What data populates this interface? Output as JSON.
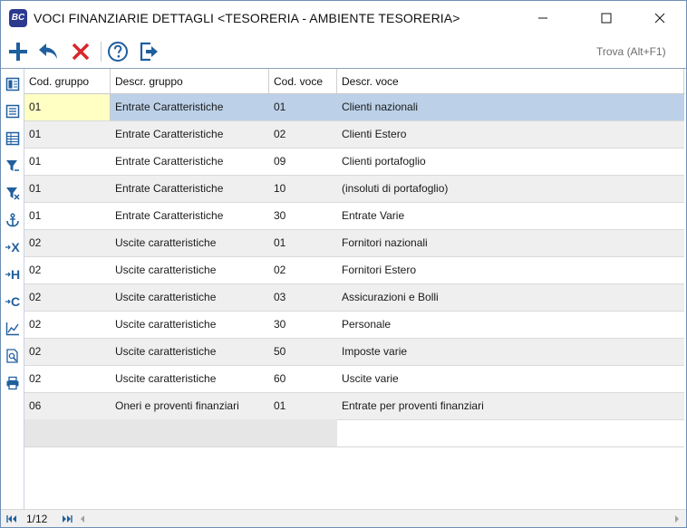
{
  "app": {
    "icon_text": "BC",
    "title": "VOCI FINANZIARIE DETTAGLI <TESORERIA - AMBIENTE TESORERIA>"
  },
  "window_controls": {
    "icons": [
      "minimize-icon",
      "maximize-icon",
      "close-icon"
    ]
  },
  "toolbar": {
    "icons": [
      "add-icon",
      "undo-icon",
      "delete-icon",
      "help-icon",
      "exit-icon"
    ],
    "search_placeholder": "Trova (Alt+F1)"
  },
  "sidebar": {
    "icons": [
      "form-view-icon",
      "list-view-icon",
      "grid-view-icon",
      "filter-icon",
      "filter-clear-icon",
      "anchor-icon",
      "column-x-icon",
      "column-h-icon",
      "column-c-icon",
      "chart-icon",
      "preview-icon",
      "print-icon"
    ],
    "letters": [
      "",
      "",
      "",
      "",
      "",
      "",
      "X",
      "H",
      "C",
      "",
      "",
      ""
    ]
  },
  "grid": {
    "columns": [
      "Cod. gruppo",
      "Descr. gruppo",
      "Cod. voce",
      "Descr. voce"
    ],
    "rows": [
      [
        "01",
        "Entrate Caratteristiche",
        "01",
        "Clienti nazionali"
      ],
      [
        "01",
        "Entrate Caratteristiche",
        "02",
        "Clienti Estero"
      ],
      [
        "01",
        "Entrate Caratteristiche",
        "09",
        "Clienti portafoglio"
      ],
      [
        "01",
        "Entrate Caratteristiche",
        "10",
        "(insoluti di portafoglio)"
      ],
      [
        "01",
        "Entrate Caratteristiche",
        "30",
        "Entrate Varie"
      ],
      [
        "02",
        "Uscite caratteristiche",
        "01",
        "Fornitori nazionali"
      ],
      [
        "02",
        "Uscite caratteristiche",
        "02",
        "Fornitori Estero"
      ],
      [
        "02",
        "Uscite caratteristiche",
        "03",
        "Assicurazioni e Bolli"
      ],
      [
        "02",
        "Uscite caratteristiche",
        "30",
        "Personale"
      ],
      [
        "02",
        "Uscite caratteristiche",
        "50",
        "Imposte varie"
      ],
      [
        "02",
        "Uscite caratteristiche",
        "60",
        "Uscite varie"
      ],
      [
        "06",
        "Oneri e proventi finanziari",
        "01",
        "Entrate per proventi finanziari"
      ]
    ],
    "selected_row": 1
  },
  "status": {
    "page": "1/12"
  },
  "colors": {
    "selected_row": "#bcd1e8",
    "focus_cell": "#ffffc4",
    "accent_blue": "#1f5f9e",
    "delete_red": "#d9262b"
  }
}
